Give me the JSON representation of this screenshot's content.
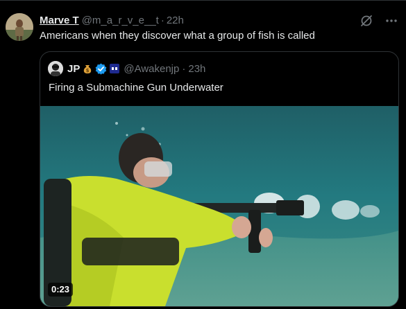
{
  "post": {
    "display_name": "Marve T",
    "handle": "@m_a_r_v_e__t",
    "separator": "·",
    "time": "22h",
    "text": "Americans when they discover what a group of fish is called",
    "icons": {
      "grok": "grok-icon",
      "more": "more-icon"
    }
  },
  "quote": {
    "display_name": "JP",
    "badges": [
      "money-bag-icon",
      "verified-badge-icon",
      "emoji-badge-icon"
    ],
    "handle": "@Awakenjp",
    "separator": "·",
    "time": "23h",
    "text": "Firing a Submachine Gun Underwater",
    "video": {
      "duration": "0:23",
      "description_icon": "video-thumbnail"
    }
  },
  "colors": {
    "background": "#000000",
    "text_primary": "#e7e9ea",
    "text_secondary": "#71767b",
    "border": "#2f3336",
    "verified": "#1d9bf0",
    "water": "#1c6a72"
  }
}
